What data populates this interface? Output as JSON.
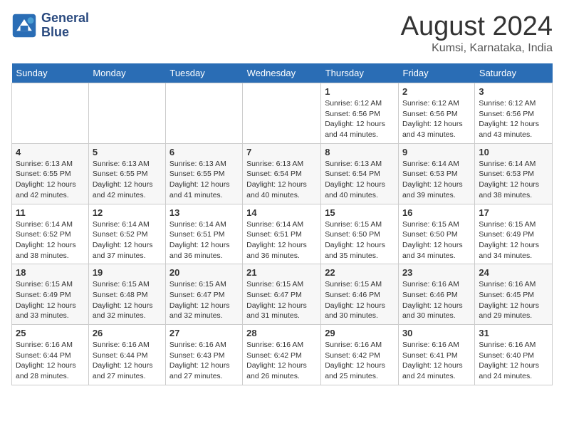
{
  "header": {
    "logo_line1": "General",
    "logo_line2": "Blue",
    "title": "August 2024",
    "subtitle": "Kumsi, Karnataka, India"
  },
  "weekdays": [
    "Sunday",
    "Monday",
    "Tuesday",
    "Wednesday",
    "Thursday",
    "Friday",
    "Saturday"
  ],
  "weeks": [
    [
      {
        "day": "",
        "info": ""
      },
      {
        "day": "",
        "info": ""
      },
      {
        "day": "",
        "info": ""
      },
      {
        "day": "",
        "info": ""
      },
      {
        "day": "1",
        "info": "Sunrise: 6:12 AM\nSunset: 6:56 PM\nDaylight: 12 hours\nand 44 minutes."
      },
      {
        "day": "2",
        "info": "Sunrise: 6:12 AM\nSunset: 6:56 PM\nDaylight: 12 hours\nand 43 minutes."
      },
      {
        "day": "3",
        "info": "Sunrise: 6:12 AM\nSunset: 6:56 PM\nDaylight: 12 hours\nand 43 minutes."
      }
    ],
    [
      {
        "day": "4",
        "info": "Sunrise: 6:13 AM\nSunset: 6:55 PM\nDaylight: 12 hours\nand 42 minutes."
      },
      {
        "day": "5",
        "info": "Sunrise: 6:13 AM\nSunset: 6:55 PM\nDaylight: 12 hours\nand 42 minutes."
      },
      {
        "day": "6",
        "info": "Sunrise: 6:13 AM\nSunset: 6:55 PM\nDaylight: 12 hours\nand 41 minutes."
      },
      {
        "day": "7",
        "info": "Sunrise: 6:13 AM\nSunset: 6:54 PM\nDaylight: 12 hours\nand 40 minutes."
      },
      {
        "day": "8",
        "info": "Sunrise: 6:13 AM\nSunset: 6:54 PM\nDaylight: 12 hours\nand 40 minutes."
      },
      {
        "day": "9",
        "info": "Sunrise: 6:14 AM\nSunset: 6:53 PM\nDaylight: 12 hours\nand 39 minutes."
      },
      {
        "day": "10",
        "info": "Sunrise: 6:14 AM\nSunset: 6:53 PM\nDaylight: 12 hours\nand 38 minutes."
      }
    ],
    [
      {
        "day": "11",
        "info": "Sunrise: 6:14 AM\nSunset: 6:52 PM\nDaylight: 12 hours\nand 38 minutes."
      },
      {
        "day": "12",
        "info": "Sunrise: 6:14 AM\nSunset: 6:52 PM\nDaylight: 12 hours\nand 37 minutes."
      },
      {
        "day": "13",
        "info": "Sunrise: 6:14 AM\nSunset: 6:51 PM\nDaylight: 12 hours\nand 36 minutes."
      },
      {
        "day": "14",
        "info": "Sunrise: 6:14 AM\nSunset: 6:51 PM\nDaylight: 12 hours\nand 36 minutes."
      },
      {
        "day": "15",
        "info": "Sunrise: 6:15 AM\nSunset: 6:50 PM\nDaylight: 12 hours\nand 35 minutes."
      },
      {
        "day": "16",
        "info": "Sunrise: 6:15 AM\nSunset: 6:50 PM\nDaylight: 12 hours\nand 34 minutes."
      },
      {
        "day": "17",
        "info": "Sunrise: 6:15 AM\nSunset: 6:49 PM\nDaylight: 12 hours\nand 34 minutes."
      }
    ],
    [
      {
        "day": "18",
        "info": "Sunrise: 6:15 AM\nSunset: 6:49 PM\nDaylight: 12 hours\nand 33 minutes."
      },
      {
        "day": "19",
        "info": "Sunrise: 6:15 AM\nSunset: 6:48 PM\nDaylight: 12 hours\nand 32 minutes."
      },
      {
        "day": "20",
        "info": "Sunrise: 6:15 AM\nSunset: 6:47 PM\nDaylight: 12 hours\nand 32 minutes."
      },
      {
        "day": "21",
        "info": "Sunrise: 6:15 AM\nSunset: 6:47 PM\nDaylight: 12 hours\nand 31 minutes."
      },
      {
        "day": "22",
        "info": "Sunrise: 6:15 AM\nSunset: 6:46 PM\nDaylight: 12 hours\nand 30 minutes."
      },
      {
        "day": "23",
        "info": "Sunrise: 6:16 AM\nSunset: 6:46 PM\nDaylight: 12 hours\nand 30 minutes."
      },
      {
        "day": "24",
        "info": "Sunrise: 6:16 AM\nSunset: 6:45 PM\nDaylight: 12 hours\nand 29 minutes."
      }
    ],
    [
      {
        "day": "25",
        "info": "Sunrise: 6:16 AM\nSunset: 6:44 PM\nDaylight: 12 hours\nand 28 minutes."
      },
      {
        "day": "26",
        "info": "Sunrise: 6:16 AM\nSunset: 6:44 PM\nDaylight: 12 hours\nand 27 minutes."
      },
      {
        "day": "27",
        "info": "Sunrise: 6:16 AM\nSunset: 6:43 PM\nDaylight: 12 hours\nand 27 minutes."
      },
      {
        "day": "28",
        "info": "Sunrise: 6:16 AM\nSunset: 6:42 PM\nDaylight: 12 hours\nand 26 minutes."
      },
      {
        "day": "29",
        "info": "Sunrise: 6:16 AM\nSunset: 6:42 PM\nDaylight: 12 hours\nand 25 minutes."
      },
      {
        "day": "30",
        "info": "Sunrise: 6:16 AM\nSunset: 6:41 PM\nDaylight: 12 hours\nand 24 minutes."
      },
      {
        "day": "31",
        "info": "Sunrise: 6:16 AM\nSunset: 6:40 PM\nDaylight: 12 hours\nand 24 minutes."
      }
    ]
  ]
}
